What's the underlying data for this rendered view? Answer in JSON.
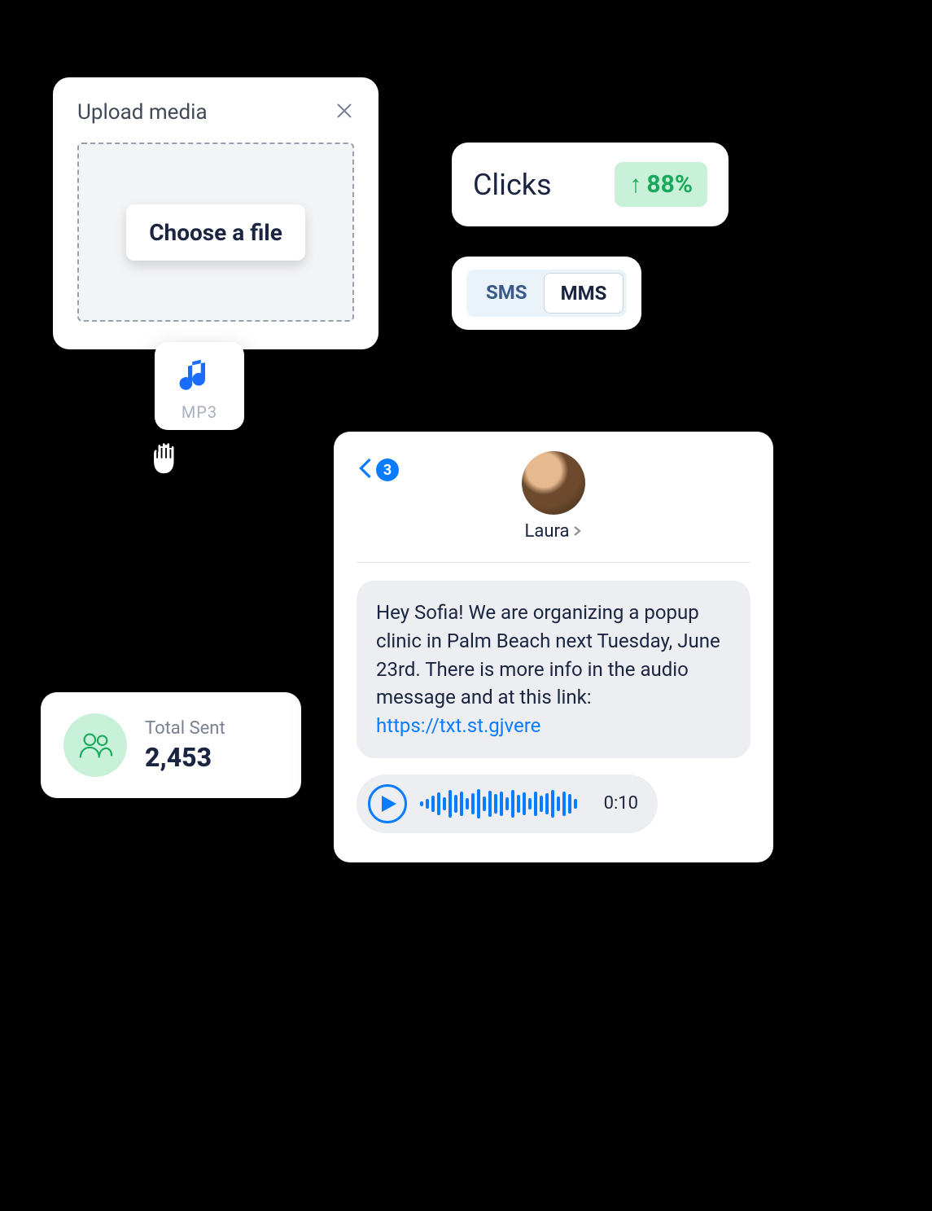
{
  "upload": {
    "title": "Upload media",
    "choose_label": "Choose a file",
    "file_ext": "MP3"
  },
  "clicks": {
    "label": "Clicks",
    "arrow": "↑",
    "value": "88%"
  },
  "toggle": {
    "sms": "SMS",
    "mms": "MMS"
  },
  "sent": {
    "label": "Total Sent",
    "value": "2,453"
  },
  "convo": {
    "back_count": "3",
    "contact_name": "Laura",
    "message_text": "Hey Sofia! We are organizing a popup clinic in Palm Beach next Tuesday, June 23rd. There is more info in the audio message and at this link: ",
    "message_link": "https://txt.st.gjvere",
    "audio_duration": "0:10"
  }
}
